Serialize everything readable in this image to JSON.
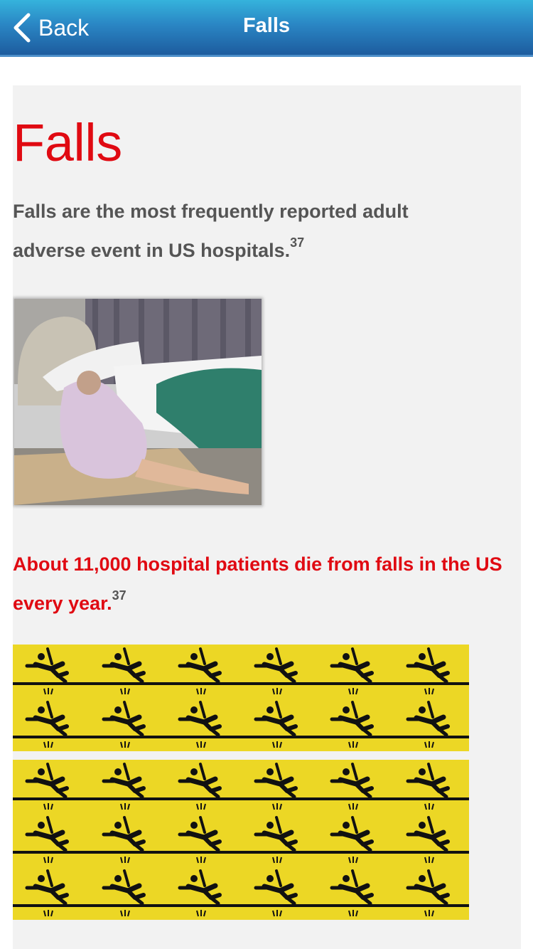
{
  "navbar": {
    "back_label": "Back",
    "title": "Falls"
  },
  "article": {
    "heading": "Falls",
    "intro_text": "Falls are the most frequently reported adult adverse event in US hospitals.",
    "intro_ref": "37",
    "stat_text": "About 11,000 hospital patients die from falls in the US every year.",
    "stat_ref": "37"
  },
  "colors": {
    "accent_red": "#e00a12",
    "nav_blue": "#2a86c4",
    "caution_yellow": "#ecd725",
    "body_gray": "#555555"
  },
  "icons": {
    "back": "chevron-left-icon",
    "falling_person": "falling-person-icon"
  }
}
